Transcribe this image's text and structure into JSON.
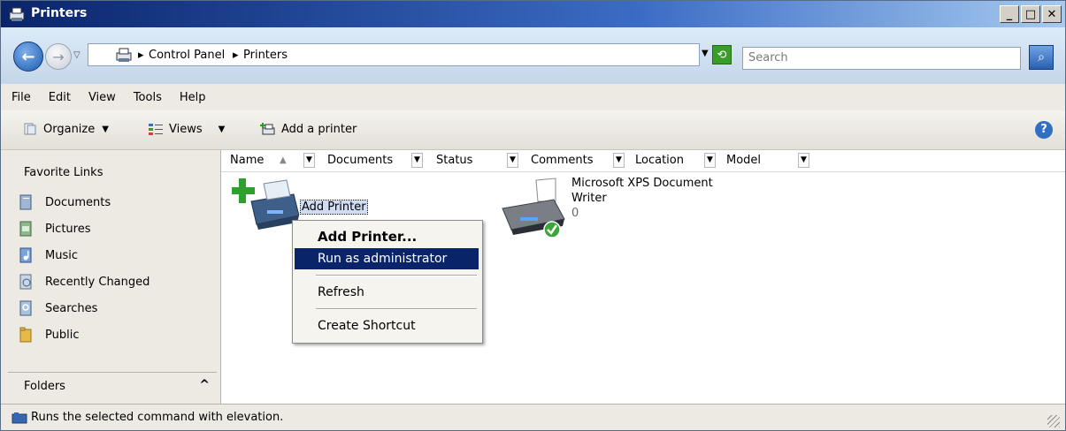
{
  "window": {
    "title": "Printers"
  },
  "address": {
    "crumbs": [
      "Control Panel",
      "Printers"
    ],
    "search_placeholder": "Search"
  },
  "menubar": {
    "items": [
      "File",
      "Edit",
      "View",
      "Tools",
      "Help"
    ]
  },
  "commandbar": {
    "organize": "Organize",
    "views": "Views",
    "add_printer": "Add a printer"
  },
  "sidebar": {
    "heading": "Favorite Links",
    "links": [
      "Documents",
      "Pictures",
      "Music",
      "Recently Changed",
      "Searches",
      "Public"
    ],
    "folders_label": "Folders"
  },
  "columns": [
    "Name",
    "Documents",
    "Status",
    "Comments",
    "Location",
    "Model"
  ],
  "items": [
    {
      "label": "Add Printer"
    },
    {
      "label_line1": "Microsoft XPS Document",
      "label_line2": "Writer",
      "count": "0"
    }
  ],
  "context_menu": {
    "items": [
      "Add Printer...",
      "Run as administrator",
      "Refresh",
      "Create Shortcut"
    ]
  },
  "status": {
    "text": "Runs the selected command with elevation."
  },
  "colors": {
    "title_start": "#0a246a",
    "highlight": "#0a246a",
    "selection": "#cfdcf1"
  }
}
